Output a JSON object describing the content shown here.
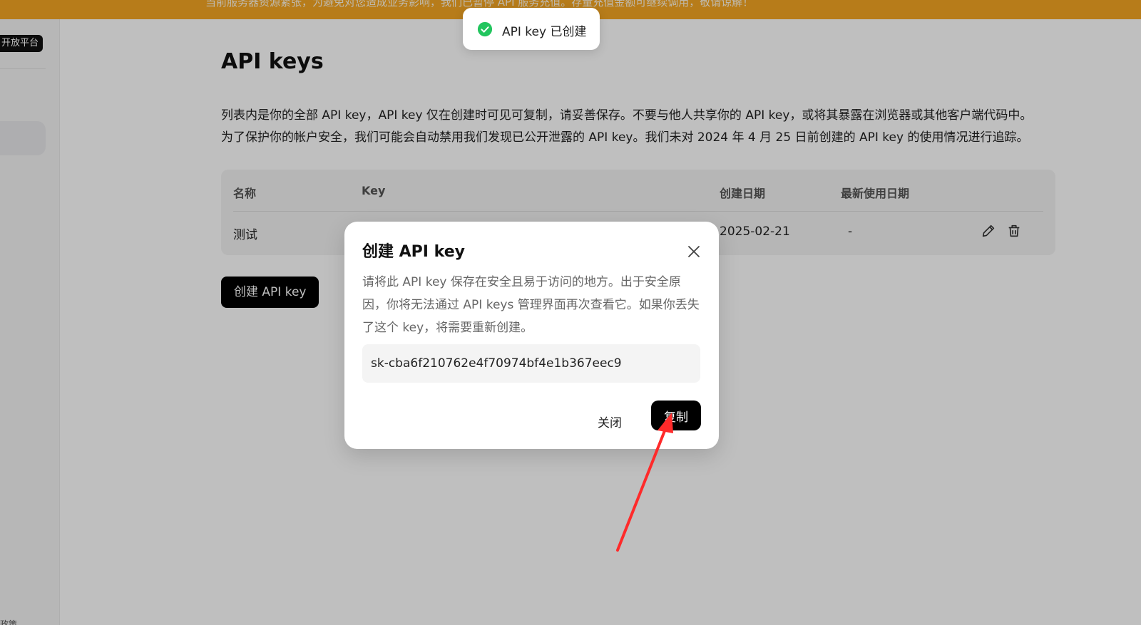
{
  "banner": {
    "text": "当前服务器资源紧张，为避免对您造成业务影响，我们已暂停 API 服务充值。存量充值金额可继续调用，敬请谅解！"
  },
  "sidebar": {
    "badge": "开放平台",
    "bottom_text": "政策"
  },
  "main": {
    "title": "API keys",
    "description_line1": "列表内是你的全部 API key，API key 仅在创建时可见可复制，请妥善保存。不要与他人共享你的 API key，或将其暴露在浏览器或其他客户端代码中。",
    "description_line2": "为了保护你的帐户安全，我们可能会自动禁用我们发现已公开泄露的 API key。我们未对 2024 年 4 月 25 日前创建的 API key 的使用情况进行追踪。",
    "table": {
      "headers": [
        "名称",
        "Key",
        "创建日期",
        "最新使用日期"
      ],
      "rows": [
        {
          "name": "测试",
          "created": "2025-02-21",
          "last_used": "-"
        }
      ]
    },
    "create_button": "创建 API key"
  },
  "toast": {
    "text": "API key 已创建",
    "icon": "check-circle-icon",
    "color": "#22c55e"
  },
  "modal": {
    "title": "创建 API key",
    "description": "请将此 API key 保存在安全且易于访问的地方。出于安全原因，你将无法通过 API keys 管理界面再次查看它。如果你丢失了这个 key，将需要重新创建。",
    "key_value": "sk-cba6f210762e4f70974bf4e1b367eec9",
    "close_label": "关闭",
    "copy_label": "复制"
  },
  "colors": {
    "banner": "#f5a623",
    "annotation_arrow": "#ff2a2a"
  }
}
